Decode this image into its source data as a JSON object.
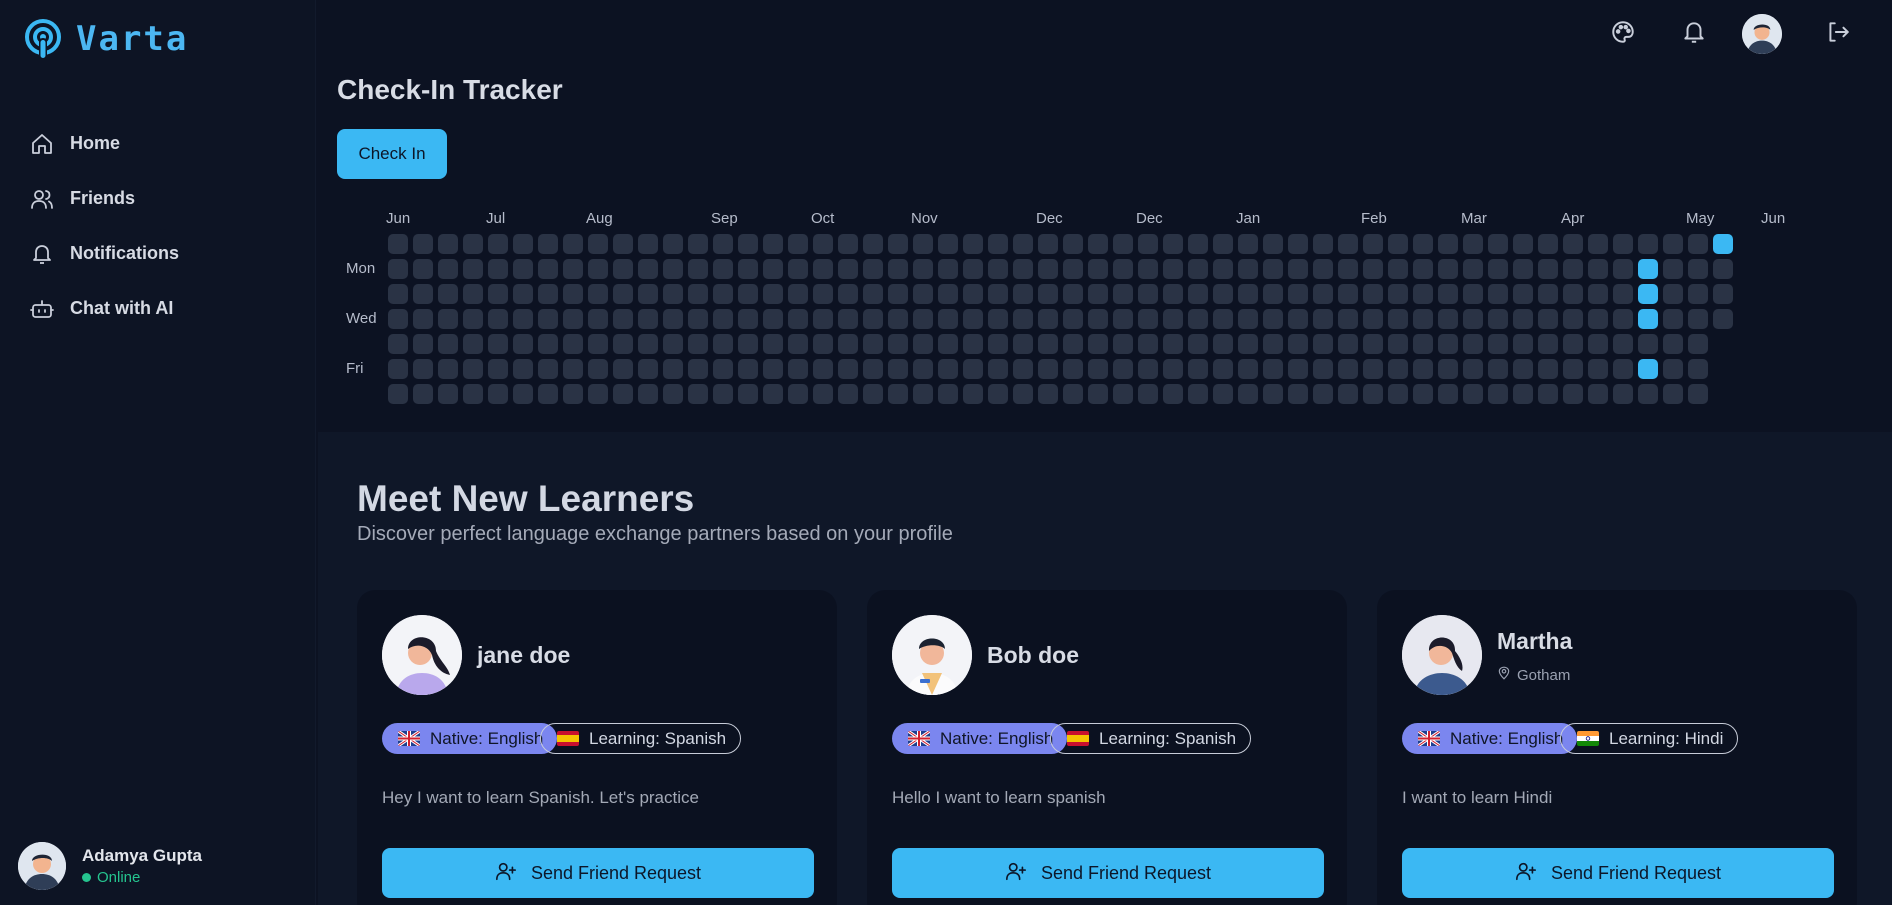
{
  "app": {
    "name": "Varta"
  },
  "sidebar": {
    "items": [
      {
        "label": "Home",
        "icon": "home-icon"
      },
      {
        "label": "Friends",
        "icon": "users-icon"
      },
      {
        "label": "Notifications",
        "icon": "bell-icon"
      },
      {
        "label": "Chat with AI",
        "icon": "bot-icon"
      }
    ],
    "user": {
      "name": "Adamya Gupta",
      "status": "Online"
    }
  },
  "header": {
    "icons": [
      "palette-icon",
      "bell-icon",
      "avatar",
      "logout-icon"
    ]
  },
  "tracker": {
    "title": "Check-In Tracker",
    "button_label": "Check In",
    "months": [
      "Jun",
      "Jul",
      "Aug",
      "Sep",
      "Oct",
      "Nov",
      "Dec",
      "Dec",
      "Jan",
      "Feb",
      "Mar",
      "Apr",
      "May",
      "Jun"
    ],
    "days": [
      "Mon",
      "Wed",
      "Fri"
    ],
    "checked_in": [
      {
        "week": 50,
        "day": 1
      },
      {
        "week": 50,
        "day": 2
      },
      {
        "week": 50,
        "day": 3
      },
      {
        "week": 50,
        "day": 5
      },
      {
        "week": 53,
        "day": 0
      }
    ]
  },
  "learners": {
    "title": "Meet New Learners",
    "subtitle": "Discover perfect language exchange partners based on your profile",
    "cards": [
      {
        "name": "jane doe",
        "location": "",
        "native": "Native: English",
        "learning": "Learning: Spanish",
        "learning_flag": "es",
        "bio": "Hey I want to learn Spanish. Let's practice",
        "button": "Send Friend Request"
      },
      {
        "name": "Bob doe",
        "location": "",
        "native": "Native: English",
        "learning": "Learning: Spanish",
        "learning_flag": "es",
        "bio": "Hello I want to learn spanish",
        "button": "Send Friend Request"
      },
      {
        "name": "Martha",
        "location": "Gotham",
        "native": "Native: English",
        "learning": "Learning: Hindi",
        "learning_flag": "in",
        "bio": "I want to learn Hindi",
        "button": "Send Friend Request"
      }
    ]
  },
  "colors": {
    "accent": "#3bb8f3",
    "native_badge": "#7b86ef",
    "online": "#25c48f"
  }
}
